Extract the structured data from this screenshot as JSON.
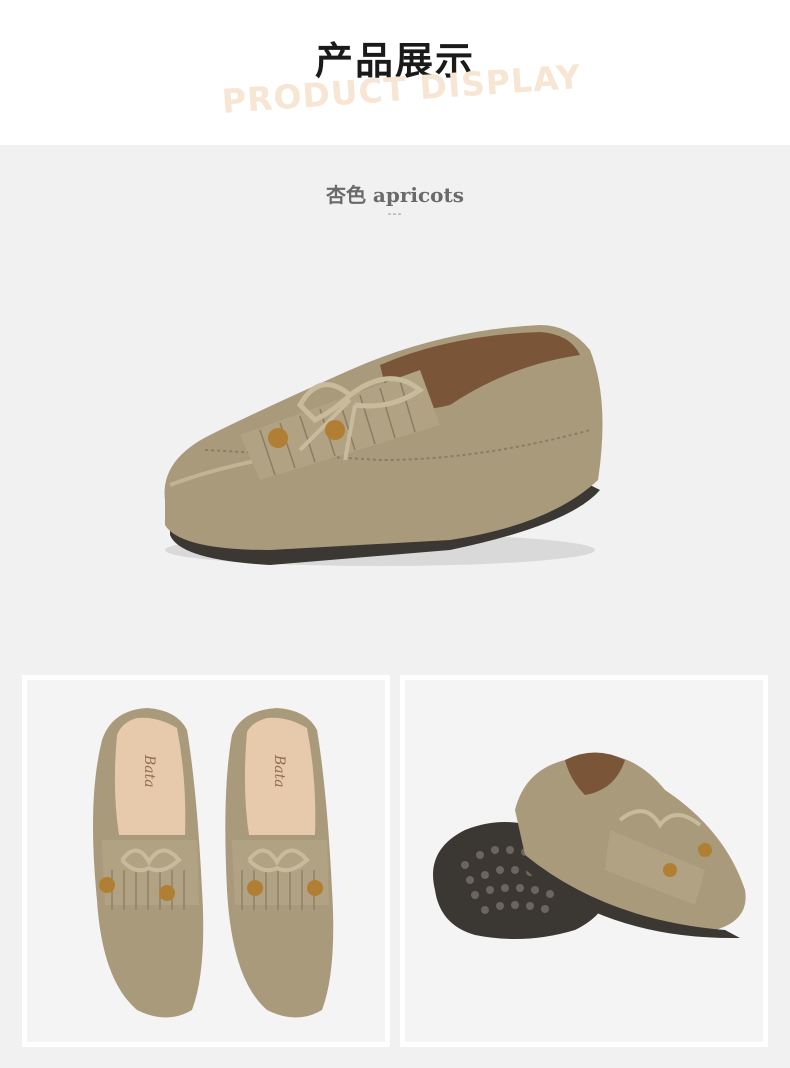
{
  "header": {
    "title_cn": "产品展示",
    "title_en": "PRODUCT DISPLAY"
  },
  "variant": {
    "label": "杏色 apricots",
    "separator": "---"
  },
  "colors": {
    "page_bg": "#f1f1f1",
    "header_bg": "#ffffff",
    "title": "#1a1a1a",
    "subtitle_watermark": "#f7e6d4",
    "suede": "#a99a7c",
    "suede_dark": "#8c7d61",
    "lining": "#7a5538",
    "sole": "#3b3733",
    "bead": "#b07f33"
  },
  "images": {
    "hero": "shoe-side-view",
    "top_view": "shoes-top-view",
    "sole_view": "shoes-sole-view"
  },
  "brand_print": "Bata"
}
